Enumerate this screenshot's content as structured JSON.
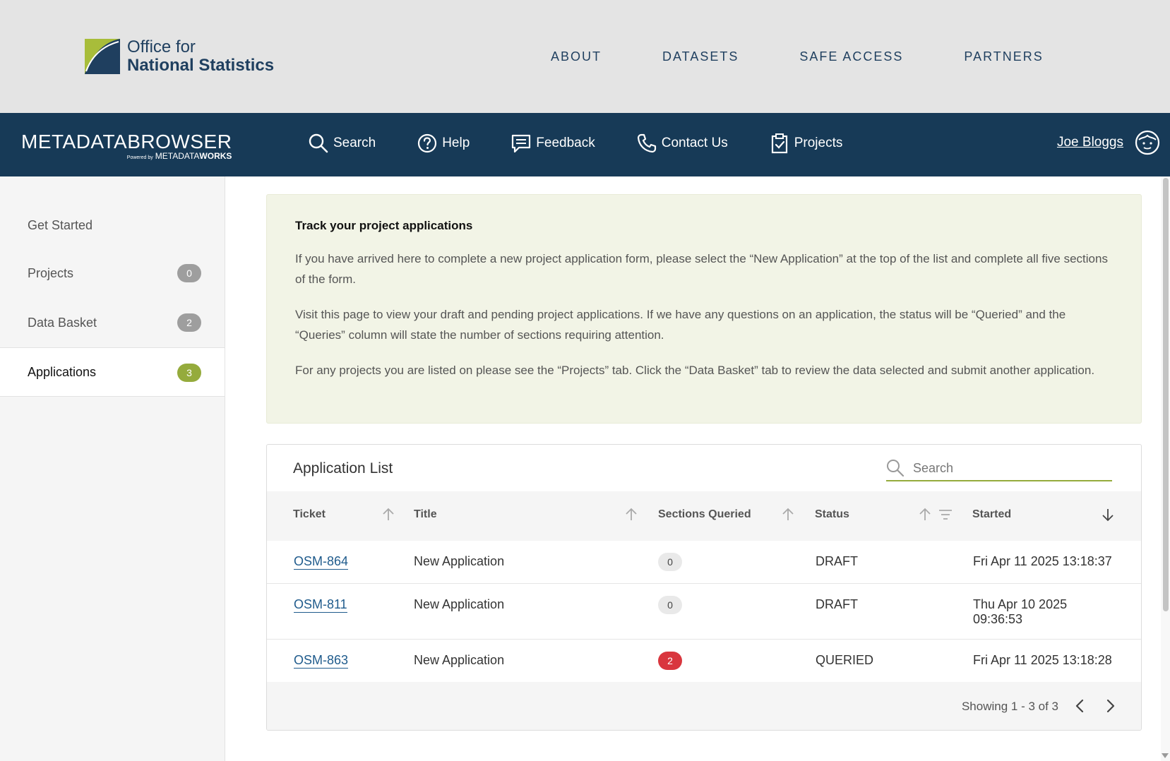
{
  "brand": {
    "ons_line1": "Office for",
    "ons_line2": "National Statistics",
    "mb_part1": "METADATA",
    "mb_part2": "BROWSER",
    "powered_by": "Powered by",
    "mw_part1": "METADATA",
    "mw_part2": "WORKS",
    "colors": {
      "navy": "#173a57",
      "ons_green": "#a8bd3a",
      "accent_green": "#95ab3c",
      "danger": "#d9363e"
    }
  },
  "top_nav": [
    "ABOUT",
    "DATASETS",
    "SAFE ACCESS",
    "PARTNERS"
  ],
  "main_nav": [
    {
      "label": "Search",
      "icon": "search-icon"
    },
    {
      "label": "Help",
      "icon": "help-icon"
    },
    {
      "label": "Feedback",
      "icon": "feedback-icon"
    },
    {
      "label": "Contact Us",
      "icon": "phone-icon"
    },
    {
      "label": "Projects",
      "icon": "clipboard-icon"
    }
  ],
  "user": {
    "name": "Joe Bloggs",
    "icon": "user-avatar-icon"
  },
  "sidebar": {
    "items": [
      {
        "label": "Get Started"
      },
      {
        "label": "Projects",
        "count": "0"
      },
      {
        "label": "Data Basket",
        "count": "2"
      },
      {
        "label": "Applications",
        "count": "3",
        "active": true
      }
    ]
  },
  "info": {
    "title": "Track your project applications",
    "p1": "If you have arrived here to complete a new project application form, please select the “New Application” at the top of the list and complete all five sections of the form.",
    "p2": "Visit this page to view your draft and pending project applications. If we have any questions on an application, the status will be “Queried” and the “Queries” column will state the number of sections requiring attention.",
    "p3": "For any projects you are listed on please see the “Projects” tab. Click the “Data Basket” tab to review the data selected and submit another application."
  },
  "app_list": {
    "title": "Application List",
    "search_placeholder": "Search",
    "columns": [
      "Ticket",
      "Title",
      "Sections Queried",
      "Status",
      "Started"
    ],
    "rows": [
      {
        "ticket": "OSM-864",
        "title": "New Application",
        "queried": "0",
        "status": "DRAFT",
        "started_1": "Fri Apr 11 2025 13:18:37",
        "started_2": ""
      },
      {
        "ticket": "OSM-811",
        "title": "New Application",
        "queried": "0",
        "status": "DRAFT",
        "started_1": "Thu Apr 10 2025",
        "started_2": "09:36:53"
      },
      {
        "ticket": "OSM-863",
        "title": "New Application",
        "queried": "2",
        "status": "QUERIED",
        "started_1": "Fri Apr 11 2025 13:18:28",
        "started_2": ""
      }
    ],
    "showing": "Showing 1 - 3 of 3"
  }
}
